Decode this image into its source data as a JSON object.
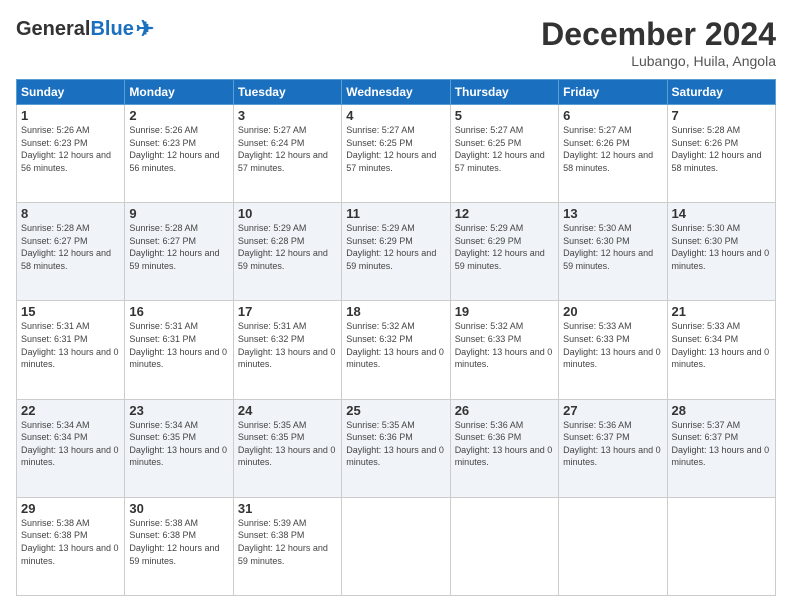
{
  "logo": {
    "general": "General",
    "blue": "Blue"
  },
  "header": {
    "month": "December 2024",
    "location": "Lubango, Huila, Angola"
  },
  "weekdays": [
    "Sunday",
    "Monday",
    "Tuesday",
    "Wednesday",
    "Thursday",
    "Friday",
    "Saturday"
  ],
  "weeks": [
    [
      {
        "day": "1",
        "sunrise": "5:26 AM",
        "sunset": "6:23 PM",
        "daylight": "12 hours and 56 minutes."
      },
      {
        "day": "2",
        "sunrise": "5:26 AM",
        "sunset": "6:23 PM",
        "daylight": "12 hours and 56 minutes."
      },
      {
        "day": "3",
        "sunrise": "5:27 AM",
        "sunset": "6:24 PM",
        "daylight": "12 hours and 57 minutes."
      },
      {
        "day": "4",
        "sunrise": "5:27 AM",
        "sunset": "6:25 PM",
        "daylight": "12 hours and 57 minutes."
      },
      {
        "day": "5",
        "sunrise": "5:27 AM",
        "sunset": "6:25 PM",
        "daylight": "12 hours and 57 minutes."
      },
      {
        "day": "6",
        "sunrise": "5:27 AM",
        "sunset": "6:26 PM",
        "daylight": "12 hours and 58 minutes."
      },
      {
        "day": "7",
        "sunrise": "5:28 AM",
        "sunset": "6:26 PM",
        "daylight": "12 hours and 58 minutes."
      }
    ],
    [
      {
        "day": "8",
        "sunrise": "5:28 AM",
        "sunset": "6:27 PM",
        "daylight": "12 hours and 58 minutes."
      },
      {
        "day": "9",
        "sunrise": "5:28 AM",
        "sunset": "6:27 PM",
        "daylight": "12 hours and 59 minutes."
      },
      {
        "day": "10",
        "sunrise": "5:29 AM",
        "sunset": "6:28 PM",
        "daylight": "12 hours and 59 minutes."
      },
      {
        "day": "11",
        "sunrise": "5:29 AM",
        "sunset": "6:29 PM",
        "daylight": "12 hours and 59 minutes."
      },
      {
        "day": "12",
        "sunrise": "5:29 AM",
        "sunset": "6:29 PM",
        "daylight": "12 hours and 59 minutes."
      },
      {
        "day": "13",
        "sunrise": "5:30 AM",
        "sunset": "6:30 PM",
        "daylight": "12 hours and 59 minutes."
      },
      {
        "day": "14",
        "sunrise": "5:30 AM",
        "sunset": "6:30 PM",
        "daylight": "13 hours and 0 minutes."
      }
    ],
    [
      {
        "day": "15",
        "sunrise": "5:31 AM",
        "sunset": "6:31 PM",
        "daylight": "13 hours and 0 minutes."
      },
      {
        "day": "16",
        "sunrise": "5:31 AM",
        "sunset": "6:31 PM",
        "daylight": "13 hours and 0 minutes."
      },
      {
        "day": "17",
        "sunrise": "5:31 AM",
        "sunset": "6:32 PM",
        "daylight": "13 hours and 0 minutes."
      },
      {
        "day": "18",
        "sunrise": "5:32 AM",
        "sunset": "6:32 PM",
        "daylight": "13 hours and 0 minutes."
      },
      {
        "day": "19",
        "sunrise": "5:32 AM",
        "sunset": "6:33 PM",
        "daylight": "13 hours and 0 minutes."
      },
      {
        "day": "20",
        "sunrise": "5:33 AM",
        "sunset": "6:33 PM",
        "daylight": "13 hours and 0 minutes."
      },
      {
        "day": "21",
        "sunrise": "5:33 AM",
        "sunset": "6:34 PM",
        "daylight": "13 hours and 0 minutes."
      }
    ],
    [
      {
        "day": "22",
        "sunrise": "5:34 AM",
        "sunset": "6:34 PM",
        "daylight": "13 hours and 0 minutes."
      },
      {
        "day": "23",
        "sunrise": "5:34 AM",
        "sunset": "6:35 PM",
        "daylight": "13 hours and 0 minutes."
      },
      {
        "day": "24",
        "sunrise": "5:35 AM",
        "sunset": "6:35 PM",
        "daylight": "13 hours and 0 minutes."
      },
      {
        "day": "25",
        "sunrise": "5:35 AM",
        "sunset": "6:36 PM",
        "daylight": "13 hours and 0 minutes."
      },
      {
        "day": "26",
        "sunrise": "5:36 AM",
        "sunset": "6:36 PM",
        "daylight": "13 hours and 0 minutes."
      },
      {
        "day": "27",
        "sunrise": "5:36 AM",
        "sunset": "6:37 PM",
        "daylight": "13 hours and 0 minutes."
      },
      {
        "day": "28",
        "sunrise": "5:37 AM",
        "sunset": "6:37 PM",
        "daylight": "13 hours and 0 minutes."
      }
    ],
    [
      {
        "day": "29",
        "sunrise": "5:38 AM",
        "sunset": "6:38 PM",
        "daylight": "13 hours and 0 minutes."
      },
      {
        "day": "30",
        "sunrise": "5:38 AM",
        "sunset": "6:38 PM",
        "daylight": "12 hours and 59 minutes."
      },
      {
        "day": "31",
        "sunrise": "5:39 AM",
        "sunset": "6:38 PM",
        "daylight": "12 hours and 59 minutes."
      },
      null,
      null,
      null,
      null
    ]
  ]
}
